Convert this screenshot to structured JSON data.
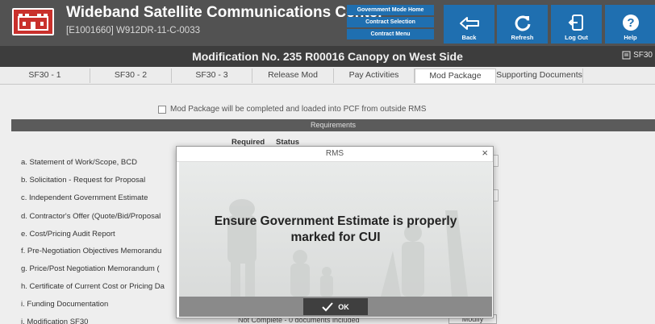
{
  "header": {
    "app_title": "Wideband Satellite Communications Center",
    "contract_id": "[E1001660] W912DR-11-C-0033",
    "logo_icon": "castle-icon",
    "mode_menu": [
      "Government Mode Home",
      "Contract Selection",
      "Contract Menu"
    ],
    "buttons": [
      {
        "label": "Back",
        "icon": "back-arrow-icon"
      },
      {
        "label": "Refresh",
        "icon": "refresh-icon"
      },
      {
        "label": "Log Out",
        "icon": "logout-icon"
      },
      {
        "label": "Help",
        "icon": "help-icon"
      }
    ],
    "accent_color": "#1f6fb0",
    "logo_color": "#c9302c"
  },
  "page": {
    "title": "Modification No. 235 R00016 Canopy on West Side",
    "sf30_link": "SF30"
  },
  "tabs": [
    {
      "label": "SF30 - 1",
      "active": false
    },
    {
      "label": "SF30 - 2",
      "active": false
    },
    {
      "label": "SF30 - 3",
      "active": false
    },
    {
      "label": "Release Mod",
      "active": false
    },
    {
      "label": "Pay Activities",
      "active": false
    },
    {
      "label": "Mod Package",
      "active": true
    },
    {
      "label": "Supporting Documents",
      "active": false
    }
  ],
  "content": {
    "checkbox_label": "Mod Package will be completed and loaded into PCF from outside RMS",
    "checkbox_checked": false,
    "requirements_header": "Requirements",
    "col_required": "Required",
    "col_status": "Status",
    "requirements": [
      "a. Statement of Work/Scope, BCD",
      "b. Solicitation - Request for Proposal",
      "c. Independent Government Estimate",
      "d. Contractor's Offer (Quote/Bid/Proposal",
      "e. Cost/Pricing Audit Report",
      "f. Pre-Negotiation Objectives Memorandu",
      "g. Price/Post Negotiation Memorandum (",
      "h. Certificate of Current Cost or Pricing Da",
      "i. Funding Documentation",
      "j. Modification SF30"
    ],
    "last_row_status": "Not Complete - 0 documents included",
    "modify_label": "Modify"
  },
  "dialog": {
    "title": "RMS",
    "close_symbol": "×",
    "message": "Ensure Government Estimate is properly marked for CUI",
    "ok_label": "OK"
  }
}
